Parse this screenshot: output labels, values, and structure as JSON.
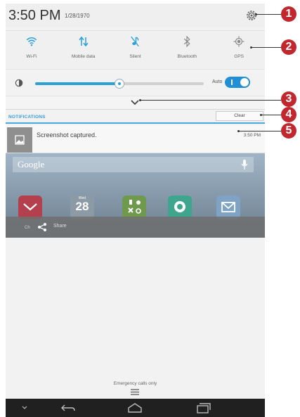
{
  "status_bar": {
    "time": "3:50 PM",
    "date": "1/28/1970",
    "settings_icon": "gear-icon"
  },
  "quick_settings": [
    {
      "label": "Wi-Fi",
      "icon": "wifi-icon"
    },
    {
      "label": "Mobile data",
      "icon": "mobile-data-icon"
    },
    {
      "label": "Silent",
      "icon": "silent-icon"
    },
    {
      "label": "Bluetooth",
      "icon": "bluetooth-icon"
    },
    {
      "label": "GPS",
      "icon": "gps-icon"
    }
  ],
  "brightness": {
    "level_fraction": 0.5,
    "auto_label": "Auto",
    "auto_on": true,
    "accent": "#2aa0d8"
  },
  "notifications": {
    "header": "NOTIFICATIONS",
    "clear_label": "Clear",
    "items": [
      {
        "text": "Screenshot captured.",
        "time": "3:50 PM",
        "icon": "image-icon"
      }
    ]
  },
  "home_preview": {
    "search_label": "Google",
    "calendar": {
      "day_name": "Wed",
      "day_number": "28"
    },
    "share_label": "Share",
    "partial_text": "Ch"
  },
  "footer": {
    "emergency_text": "Emergency calls only"
  },
  "callouts": [
    "1",
    "2",
    "3",
    "4",
    "5"
  ],
  "colors": {
    "callout": "#c1272d",
    "accent": "#3d9cd6",
    "nav_bg": "#202020"
  }
}
